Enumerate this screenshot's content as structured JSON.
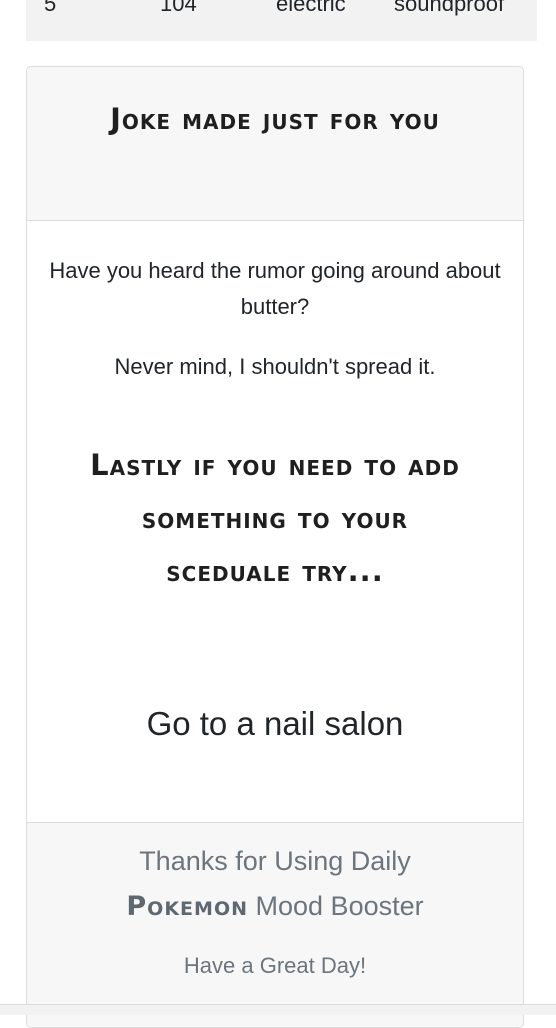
{
  "table_row": {
    "cells": [
      "5",
      "104",
      "electric",
      "soundproof"
    ]
  },
  "joke_card": {
    "title": "Joke made just for you",
    "setup": "Have you heard the rumor going around about butter?",
    "punchline": "Never mind, I shouldn't spread it.",
    "lastly_heading": "Lastly if you need to add something to your sceduale try...",
    "suggestion": "Go to a nail salon"
  },
  "footer": {
    "thanks_prefix": "Thanks for Using Daily",
    "brand": "Pokemon",
    "thanks_suffix": "Mood Booster",
    "farewell": "Have a Great Day!"
  },
  "colors": {
    "heading": "#1f1f1f",
    "muted_text": "#6c757d",
    "card_bg": "#f7f7f7",
    "border": "#dcdcdc"
  }
}
